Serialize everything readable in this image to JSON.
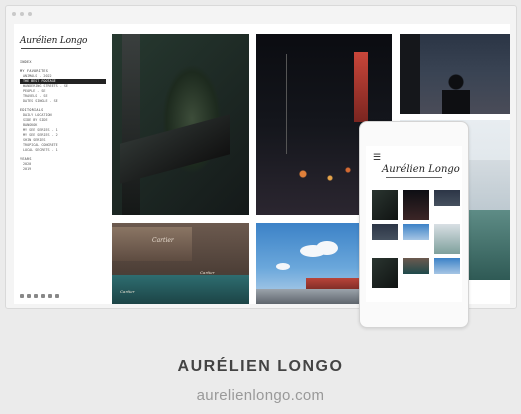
{
  "site": {
    "logo_text": "Aurélien Longo",
    "menu": [
      {
        "text": "INDEX",
        "kind": "h"
      },
      {
        "text": "MY FAVORITES",
        "kind": "h"
      },
      {
        "text": "ANIMALS - 2022",
        "kind": "sub"
      },
      {
        "text": "THE BEST FOOTAGE",
        "kind": "hl"
      },
      {
        "text": "WANDERING STREETS - SE",
        "kind": "sub"
      },
      {
        "text": "PEOPLE - SE",
        "kind": "sub"
      },
      {
        "text": "TRAVELS - SE",
        "kind": "sub"
      },
      {
        "text": "DATES SINGLE - SE",
        "kind": "sub"
      },
      {
        "text": "EDITORIALS",
        "kind": "h"
      },
      {
        "text": "DAILY LOCATION",
        "kind": "sub"
      },
      {
        "text": "SIDE BY SIDE",
        "kind": "sub"
      },
      {
        "text": "BANGKOK",
        "kind": "sub"
      },
      {
        "text": "MY SEE SERIES - 1",
        "kind": "sub"
      },
      {
        "text": "MY SEE SERIES - 2",
        "kind": "sub"
      },
      {
        "text": "SHIN SERIES",
        "kind": "sub"
      },
      {
        "text": "TROPICAL CONCRETE",
        "kind": "sub"
      },
      {
        "text": "LOCAL SECRETS - 1",
        "kind": "sub"
      },
      {
        "text": "YEARS",
        "kind": "h"
      },
      {
        "text": "2020",
        "kind": "sub"
      },
      {
        "text": "2019",
        "kind": "sub"
      }
    ],
    "photo_signs": {
      "cartier": "Cartier",
      "cartier_small": "Cartier",
      "cartier_tiny": "Cartier"
    }
  },
  "phone": {
    "logo_text": "Aurélien Longo",
    "menu_icon": "☰"
  },
  "caption": {
    "title": "AURÉLIEN LONGO",
    "url": "aurelienlongo.com"
  }
}
